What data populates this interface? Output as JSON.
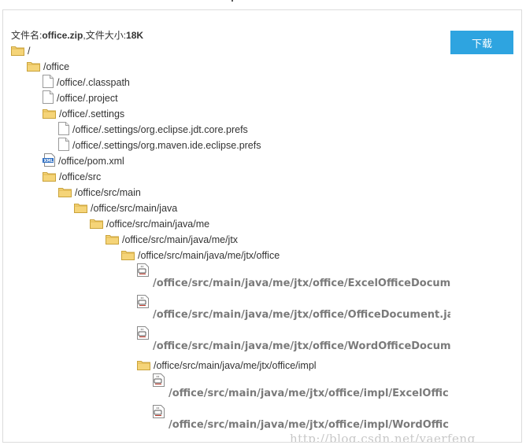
{
  "file_info": {
    "name_label": "文件名:",
    "name_value": "office.zip",
    "size_label": ",文件大小:",
    "size_value": "18K"
  },
  "download_label": "下载",
  "tree": [
    {
      "path": "/",
      "type": "folder",
      "depth": 0
    },
    {
      "path": "/office",
      "type": "folder",
      "depth": 1
    },
    {
      "path": "/office/.classpath",
      "type": "file",
      "depth": 2
    },
    {
      "path": "/office/.project",
      "type": "file",
      "depth": 2
    },
    {
      "path": "/office/.settings",
      "type": "folder",
      "depth": 2
    },
    {
      "path": "/office/.settings/org.eclipse.jdt.core.prefs",
      "type": "file",
      "depth": 3
    },
    {
      "path": "/office/.settings/org.maven.ide.eclipse.prefs",
      "type": "file",
      "depth": 3
    },
    {
      "path": "/office/pom.xml",
      "type": "xml",
      "depth": 2
    },
    {
      "path": "/office/src",
      "type": "folder",
      "depth": 2
    },
    {
      "path": "/office/src/main",
      "type": "folder",
      "depth": 3
    },
    {
      "path": "/office/src/main/java",
      "type": "folder",
      "depth": 4
    },
    {
      "path": "/office/src/main/java/me",
      "type": "folder",
      "depth": 5
    },
    {
      "path": "/office/src/main/java/me/jtx",
      "type": "folder",
      "depth": 6
    },
    {
      "path": "/office/src/main/java/me/jtx/office",
      "type": "folder",
      "depth": 7
    },
    {
      "path": "/office/src/main/java/me/jtx/office/ExcelOfficeDocum",
      "type": "code",
      "depth": 8
    },
    {
      "path": "/office/src/main/java/me/jtx/office/OfficeDocument.ja",
      "type": "code",
      "depth": 8
    },
    {
      "path": "/office/src/main/java/me/jtx/office/WordOfficeDocum",
      "type": "code",
      "depth": 8
    },
    {
      "path": "/office/src/main/java/me/jtx/office/impl",
      "type": "folder",
      "depth": 8
    },
    {
      "path": "/office/src/main/java/me/jtx/office/impl/ExcelOffic",
      "type": "code",
      "depth": 9
    },
    {
      "path": "/office/src/main/java/me/jtx/office/impl/WordOffic",
      "type": "code",
      "depth": 9
    }
  ],
  "watermark": "http://blog.csdn.net/yaerfeng",
  "colors": {
    "button": "#2ea4e0",
    "folder": "#f0c95b",
    "code_text": "#7a7a7a"
  }
}
